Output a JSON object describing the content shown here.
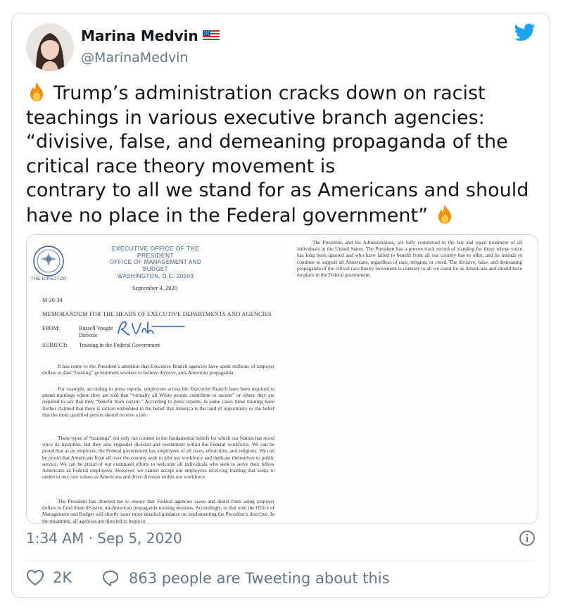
{
  "author": {
    "name": "Marina Medvin",
    "handle": "@MarinaMedvin",
    "flag_icon": "us-flag-icon"
  },
  "tweet": {
    "line1": "Trump’s administration cracks down on racist",
    "line2": "teachings in various executive branch agencies:",
    "line3": "“divisive, false, and demeaning propaganda of the",
    "line4": "critical race theory movement is",
    "line5": "contrary to all we stand for as Americans and should",
    "line6": "have no place in the Federal government”"
  },
  "document": {
    "office_line1": "EXECUTIVE OFFICE OF THE PRESIDENT",
    "office_line2": "OFFICE OF MANAGEMENT AND BUDGET",
    "office_line3": "WASHINGTON, D.C. 20503",
    "director_label": "THE DIRECTOR",
    "date": "September 4, 2020",
    "memo_number": "M-20-34",
    "memo_title": "MEMORANDUM FOR THE HEADS OF EXECUTIVE DEPARTMENTS AND AGENCIES",
    "from_label": "FROM:",
    "from_name": "Russell Vought",
    "from_title": "Director",
    "subject_label": "SUBJECT:",
    "subject": "Training in the Federal Government",
    "para1": "It has come to the President’s attention that Executive Branch agencies have spent millions of taxpayer dollars to date “training” government workers to believe divisive, anti-American propaganda.",
    "para2": "For example, according to press reports, employees across the Executive Branch have been required to attend trainings where they are told that “virtually all White people contribute to racism” or where they are required to say that they “benefit from racism.” According to press reports, in some cases these training have further claimed that there is racism embedded in the belief that America is the land of opportunity or the belief that the most qualified person should receive a job.",
    "para3": "These types of “trainings” not only run counter to the fundamental beliefs for which our Nation has stood since its inception, but they also engender division and resentment within the Federal workforce. We can be proud that as an employer, the Federal government has employees of all races, ethnicities, and religions. We can be proud that Americans from all over the country seek to join our workforce and dedicate themselves to public service. We can be proud of our continued efforts to welcome all individuals who seek to serve their fellow Americans as Federal employees. However, we cannot accept our employees receiving training that seeks to undercut our core values as Americans and drive division within our workforce.",
    "para4": "The President has directed me to ensure that Federal agencies cease and desist from using taxpayer dollars to fund these divisive, un-American propaganda training sessions. Accordingly, to that end, the Office of Management and Budget will shortly issue more detailed guidance on implementing the President’s directive. In the meantime, all agencies are directed to begin to",
    "para_right": "The President, and his Administration, are fully committed to the fair and equal treatment of all individuals in the United States. The President has a proven track record of standing for those whose voice has long been ignored and who have failed to benefit from all our country has to offer, and he intends to continue to support all Americans, regardless of race, religion, or creed. The divisive, false, and demeaning propaganda of the critical race theory movement is contrary to all we stand for as Americans and should have no place in the Federal government."
  },
  "meta": {
    "timestamp": "1:34 AM · Sep 5, 2020",
    "likes": "2K",
    "conversation": "863 people are Tweeting about this"
  },
  "colors": {
    "twitter_blue": "#1da1f2",
    "gray": "#657786",
    "border": "#cfd9de"
  }
}
